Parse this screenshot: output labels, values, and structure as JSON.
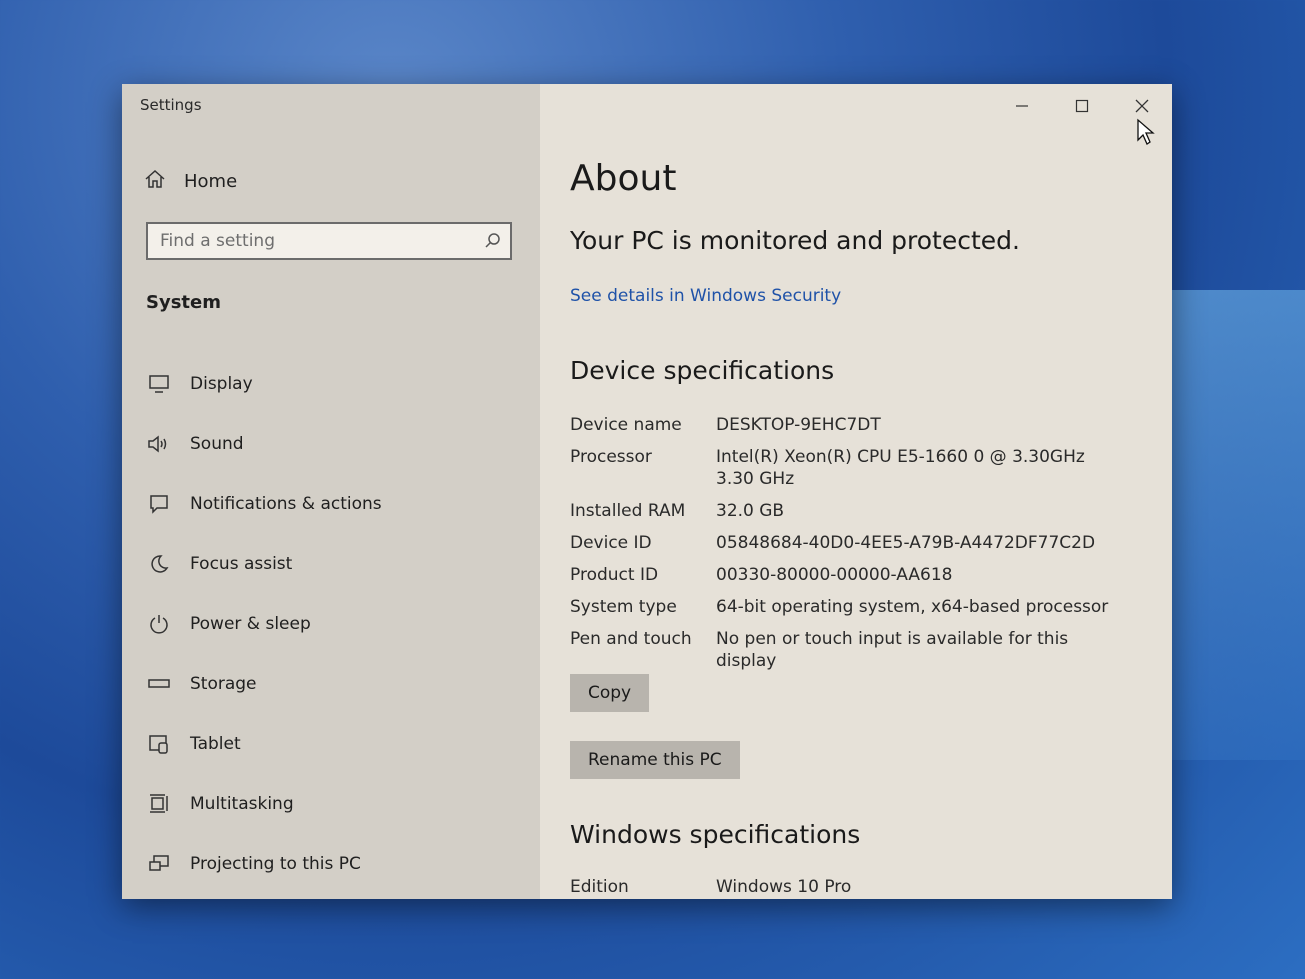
{
  "window": {
    "title": "Settings"
  },
  "sidebar": {
    "home_label": "Home",
    "search_placeholder": "Find a setting",
    "section_title": "System",
    "items": [
      {
        "label": "Display",
        "icon": "monitor-icon"
      },
      {
        "label": "Sound",
        "icon": "speaker-icon"
      },
      {
        "label": "Notifications & actions",
        "icon": "notification-icon"
      },
      {
        "label": "Focus assist",
        "icon": "moon-icon"
      },
      {
        "label": "Power & sleep",
        "icon": "power-icon"
      },
      {
        "label": "Storage",
        "icon": "storage-icon"
      },
      {
        "label": "Tablet",
        "icon": "tablet-icon"
      },
      {
        "label": "Multitasking",
        "icon": "multitasking-icon"
      },
      {
        "label": "Projecting to this PC",
        "icon": "projector-icon"
      }
    ]
  },
  "main": {
    "title": "About",
    "protection_status": "Your PC is monitored and protected.",
    "security_link": "See details in Windows Security",
    "device_specs": {
      "heading": "Device specifications",
      "rows": [
        {
          "label": "Device name",
          "value": "DESKTOP-9EHC7DT"
        },
        {
          "label": "Processor",
          "value": "Intel(R) Xeon(R) CPU E5-1660 0 @ 3.30GHz   3.30 GHz"
        },
        {
          "label": "Installed RAM",
          "value": "32.0 GB"
        },
        {
          "label": "Device ID",
          "value": "05848684-40D0-4EE5-A79B-A4472DF77C2D"
        },
        {
          "label": "Product ID",
          "value": "00330-80000-00000-AA618"
        },
        {
          "label": "System type",
          "value": "64-bit operating system, x64-based processor"
        },
        {
          "label": "Pen and touch",
          "value": "No pen or touch input is available for this display"
        }
      ],
      "copy_button": "Copy",
      "rename_button": "Rename this PC"
    },
    "windows_specs": {
      "heading": "Windows specifications",
      "rows": [
        {
          "label": "Edition",
          "value": "Windows 10 Pro"
        }
      ]
    }
  }
}
